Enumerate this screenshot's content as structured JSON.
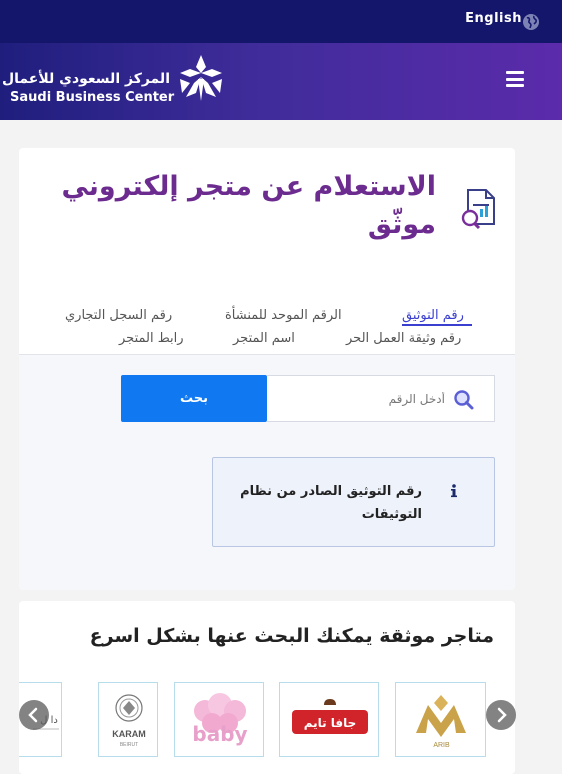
{
  "topbar": {
    "language_label": "English"
  },
  "header": {
    "logo_arabic": "المركز السعودي للأعمال",
    "logo_english": "Saudi Business Center"
  },
  "inquiry": {
    "title": "الاستعلام عن متجر إلكتروني موثّق",
    "tabs": [
      {
        "label": "رقم التوثيق",
        "active": true
      },
      {
        "label": "الرقم الموحد للمنشأة",
        "active": false
      },
      {
        "label": "رقم السجل التجاري",
        "active": false
      },
      {
        "label": "رقم وثيقة العمل الحر",
        "active": false
      },
      {
        "label": "اسم المتجر",
        "active": false
      },
      {
        "label": "رابط المتجر",
        "active": false
      }
    ],
    "search": {
      "placeholder": "أدخل الرقم",
      "button_label": "بحث"
    },
    "info_text": "رقم التوثيق الصادر من نظام التوثيقات"
  },
  "stores": {
    "section_title": "متاجر موثقة يمكنك البحث عنها بشكل اسرع",
    "logos": [
      {
        "name": "arib",
        "text": "ARIB"
      },
      {
        "name": "jafa-time",
        "text": "جافا تايم"
      },
      {
        "name": "baby",
        "text": "baby"
      },
      {
        "name": "karam",
        "text": "KARAM",
        "subtext": "BEIRUT"
      },
      {
        "name": "partial",
        "text": "دا ل"
      }
    ]
  },
  "colors": {
    "topbar": "#13166b",
    "title": "#6c2b8e",
    "accent": "#1079f2",
    "tab_active": "#3b3fd0",
    "logo_border": "#b7dcec"
  }
}
